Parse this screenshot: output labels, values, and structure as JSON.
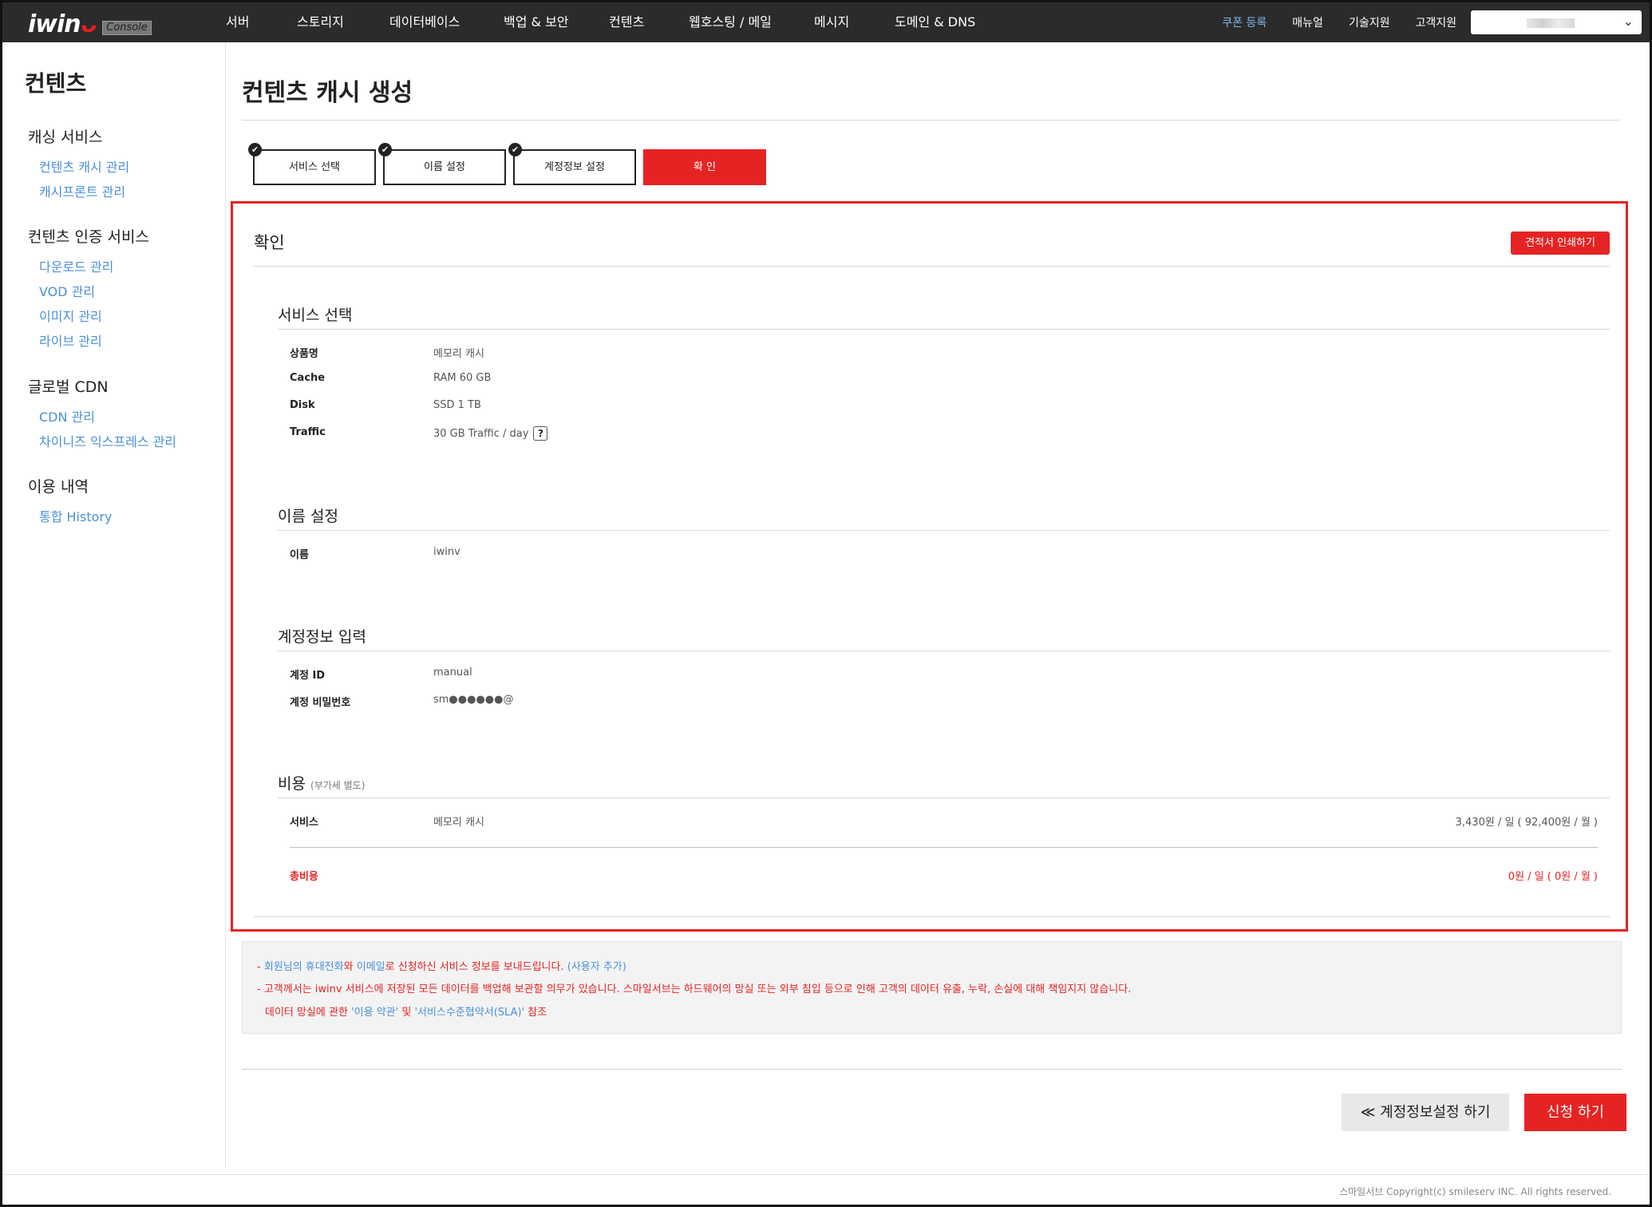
{
  "header": {
    "logo": "iwin",
    "logo_smile": "ᴗ",
    "console_badge": "Console",
    "nav": [
      "서버",
      "스토리지",
      "데이터베이스",
      "백업 & 보안",
      "컨텐츠",
      "웹호스팅 / 메일",
      "메시지",
      "도메인 & DNS"
    ],
    "coupon": "쿠폰 등록",
    "manual": "매뉴얼",
    "tech_support": "기술지원",
    "customer_support": "고객지원",
    "account_chevron": "⌄"
  },
  "sidebar": {
    "title": "컨텐츠",
    "groups": [
      {
        "title": "캐싱 서비스",
        "links": [
          "컨텐츠 캐시 관리",
          "캐시프론트 관리"
        ]
      },
      {
        "title": "컨텐츠 인증 서비스",
        "links": [
          "다운로드 관리",
          "VOD 관리",
          "이미지 관리",
          "라이브 관리"
        ]
      },
      {
        "title": "글로벌 CDN",
        "links": [
          "CDN 관리",
          "차이니즈 익스프레스 관리"
        ]
      },
      {
        "title": "이용 내역",
        "links": [
          "통합 History"
        ]
      }
    ]
  },
  "page_title": "컨텐츠 캐시 생성",
  "steps": [
    "서비스 선택",
    "이름 설정",
    "계정정보 설정",
    "확 인"
  ],
  "check_glyph": "✔",
  "confirm": {
    "title": "확인",
    "quote_button": "견적서 인쇄하기",
    "service": {
      "title": "서비스 선택",
      "rows": [
        {
          "k": "상품명",
          "v": "메모리 캐시"
        },
        {
          "k": "Cache",
          "v": "RAM 60 GB"
        },
        {
          "k": "Disk",
          "v": "SSD 1 TB"
        },
        {
          "k": "Traffic",
          "v": "30 GB Traffic / day"
        }
      ],
      "help": "?"
    },
    "name": {
      "title": "이름 설정",
      "rows": [
        {
          "k": "이름",
          "v": "iwinv"
        }
      ]
    },
    "account": {
      "title": "계정정보 입력",
      "rows": [
        {
          "k": "계정 ID",
          "v": "manual"
        },
        {
          "k": "계정 비밀번호",
          "v": "sm●●●●●●@"
        }
      ]
    },
    "cost": {
      "title": "비용",
      "title_note": "(부가세 별도)",
      "service_label": "서비스",
      "service_name": "메모리 캐시",
      "service_price": "3,430원 / 일 ( 92,400원 / 월 )",
      "total_label": "총비용",
      "total_price": "0원 / 일 ( 0원 / 월 )"
    }
  },
  "notice": {
    "l1_a": "- ",
    "l1_b": "회원님의 휴대전화",
    "l1_c": "와 ",
    "l1_d": "이메일",
    "l1_e": "로 신청하신 서비스 정보를 보내드립니다. ",
    "l1_f": "(사용자 추가)",
    "l2": "- 고객께서는 iwinv 서비스에 저장된 모든 데이터를 백업해 보관할 의무가 있습니다. 스마일서브는 하드웨어의 망실 또는 외부 침입 등으로 인해 고객의 데이터 유출, 누락, 손실에 대해 책임지지 않습니다.",
    "l3_a": "데이터 망실에 관한 ",
    "l3_b": "'이용 약관'",
    "l3_c": " 및 ",
    "l3_d": "'서비스수준협약서(SLA)'",
    "l3_e": " 참조"
  },
  "buttons": {
    "prev": "≪ 계정정보설정 하기",
    "submit": "신청 하기"
  },
  "footer": {
    "copyright": "스마일서브 Copyright(c) smileserv INC. All rights reserved."
  }
}
